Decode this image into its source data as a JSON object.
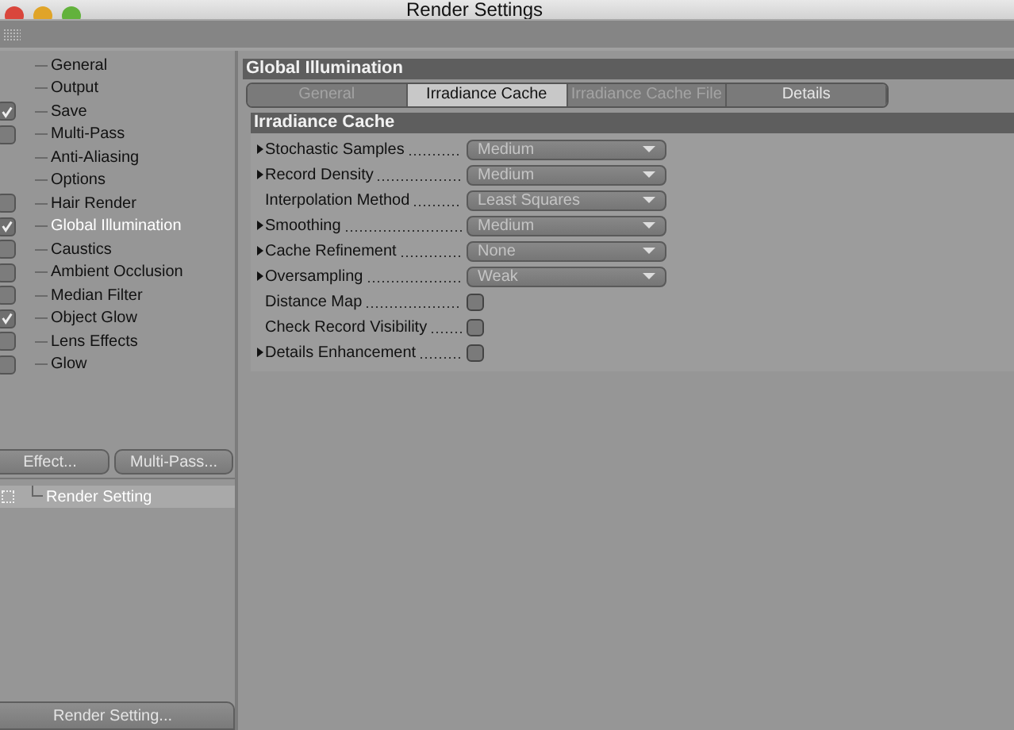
{
  "window": {
    "title": "Render Settings"
  },
  "sidebar": {
    "items": [
      {
        "label": "General",
        "kind": "plain",
        "selected": false
      },
      {
        "label": "Output",
        "kind": "plain",
        "selected": false
      },
      {
        "label": "Save",
        "kind": "check",
        "checked": true,
        "selected": false
      },
      {
        "label": "Multi-Pass",
        "kind": "check",
        "checked": false,
        "selected": false
      },
      {
        "label": "Anti-Aliasing",
        "kind": "plain",
        "selected": false
      },
      {
        "label": "Options",
        "kind": "plain",
        "selected": false
      },
      {
        "label": "Hair Render",
        "kind": "check",
        "checked": false,
        "selected": false
      },
      {
        "label": "Global Illumination",
        "kind": "check",
        "checked": true,
        "selected": true
      },
      {
        "label": "Caustics",
        "kind": "check",
        "checked": false,
        "selected": false
      },
      {
        "label": "Ambient Occlusion",
        "kind": "check",
        "checked": false,
        "selected": false
      },
      {
        "label": "Median Filter",
        "kind": "check",
        "checked": false,
        "selected": false
      },
      {
        "label": "Object Glow",
        "kind": "check",
        "checked": true,
        "selected": false
      },
      {
        "label": "Lens Effects",
        "kind": "check",
        "checked": false,
        "selected": false
      },
      {
        "label": "Glow",
        "kind": "check",
        "checked": false,
        "selected": false
      }
    ],
    "buttons": [
      "Effect...",
      "Multi-Pass..."
    ],
    "settings_list": [
      {
        "label": "Render Setting",
        "selected": true
      }
    ],
    "bottom_button": "Render Setting..."
  },
  "panel": {
    "title": "Global Illumination",
    "tabs": [
      {
        "label": "General",
        "selected": false,
        "disabled": true
      },
      {
        "label": "Irradiance Cache",
        "selected": true,
        "disabled": false
      },
      {
        "label": "Irradiance Cache File",
        "selected": false,
        "disabled": true
      },
      {
        "label": "Details",
        "selected": false,
        "disabled": false
      }
    ],
    "section": "Irradiance Cache",
    "rows": [
      {
        "label": "Stochastic Samples",
        "expandable": true,
        "kind": "dropdown",
        "value": "Medium"
      },
      {
        "label": "Record Density",
        "expandable": true,
        "kind": "dropdown",
        "value": "Medium"
      },
      {
        "label": "Interpolation Method",
        "expandable": false,
        "kind": "dropdown",
        "value": "Least Squares"
      },
      {
        "label": "Smoothing",
        "expandable": true,
        "kind": "dropdown",
        "value": "Medium"
      },
      {
        "label": "Cache Refinement",
        "expandable": true,
        "kind": "dropdown",
        "value": "None"
      },
      {
        "label": "Oversampling",
        "expandable": true,
        "kind": "dropdown",
        "value": "Weak"
      },
      {
        "label": "Distance Map",
        "expandable": false,
        "kind": "checkbox",
        "checked": false
      },
      {
        "label": "Check Record Visibility",
        "expandable": false,
        "kind": "checkbox",
        "checked": false
      },
      {
        "label": "Details Enhancement",
        "expandable": true,
        "kind": "checkbox",
        "checked": false
      }
    ]
  }
}
